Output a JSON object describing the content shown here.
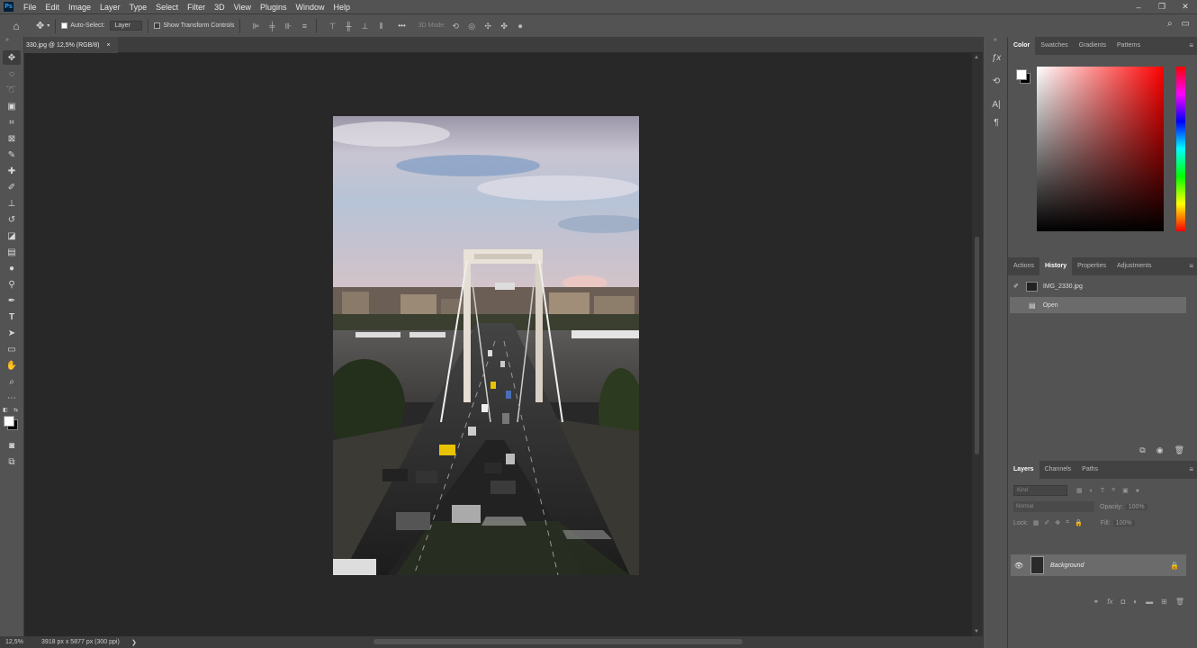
{
  "app": {
    "logo": "Ps",
    "menu": [
      "File",
      "Edit",
      "Image",
      "Layer",
      "Type",
      "Select",
      "Filter",
      "3D",
      "View",
      "Plugins",
      "Window",
      "Help"
    ],
    "window_controls": [
      "–",
      "❐",
      "✕"
    ]
  },
  "options_bar": {
    "auto_select_label": "Auto-Select:",
    "auto_select_value": "Layer",
    "show_transform_label": "Show Transform Controls",
    "mode_3d_label": "3D Mode:",
    "more": "•••"
  },
  "document": {
    "tab_title": "330.jpg @ 12,5% (RGB/8)",
    "tab_close": "×",
    "zoom": "12,5%",
    "info": "3918 px x 5877 px (300 ppi)",
    "status_arrow": "❯"
  },
  "color_panel": {
    "tabs": [
      "Color",
      "Swatches",
      "Gradients",
      "Patterns"
    ],
    "active_tab": "Color",
    "foreground": "#ffffff",
    "background": "#000000",
    "hue": "#ff0000"
  },
  "history_panel": {
    "tabs": [
      "Actions",
      "History",
      "Properties",
      "Adjustments"
    ],
    "active_tab": "History",
    "snapshot": "IMG_2330.jpg",
    "states": [
      "Open"
    ]
  },
  "layers_panel": {
    "tabs": [
      "Layers",
      "Channels",
      "Paths"
    ],
    "active_tab": "Layers",
    "kind_placeholder": "Kind",
    "blend_mode": "Normal",
    "opacity_label": "Opacity:",
    "opacity_value": "100%",
    "lock_label": "Lock:",
    "fill_label": "Fill:",
    "fill_value": "100%",
    "layers": [
      {
        "name": "Background",
        "visible": true,
        "locked": true
      }
    ]
  }
}
